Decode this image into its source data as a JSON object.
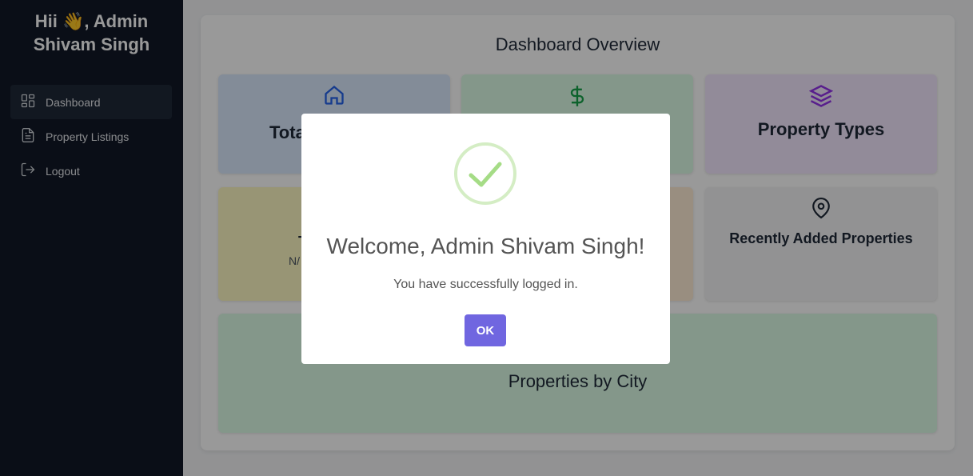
{
  "sidebar": {
    "greeting_line1": "Hii 👋, Admin",
    "greeting_line2": "Shivam Singh",
    "items": [
      {
        "label": "Dashboard",
        "icon": "dashboard-grid-icon",
        "active": true
      },
      {
        "label": "Property Listings",
        "icon": "document-icon",
        "active": false
      },
      {
        "label": "Logout",
        "icon": "logout-icon",
        "active": false
      }
    ]
  },
  "main": {
    "title": "Dashboard Overview",
    "cards": {
      "total_properties": {
        "title_visible": "Tota",
        "icon": "home-icon"
      },
      "revenue": {
        "icon": "dollar-icon"
      },
      "property_types": {
        "title": "Property Types",
        "icon": "layers-icon"
      },
      "card4": {
        "title_visible": "T",
        "sub_visible": "N/"
      },
      "recently_added": {
        "title": "Recently Added Properties",
        "icon": "map-pin-icon"
      },
      "properties_by_city": {
        "title": "Properties by City"
      }
    }
  },
  "modal": {
    "title": "Welcome, Admin Shivam Singh!",
    "text": "You have successfully logged in.",
    "ok_label": "OK",
    "icon": "success-check-icon"
  },
  "colors": {
    "sidebar_bg": "#111827",
    "accent_button": "#7066e0",
    "success": "#a5dc86"
  }
}
